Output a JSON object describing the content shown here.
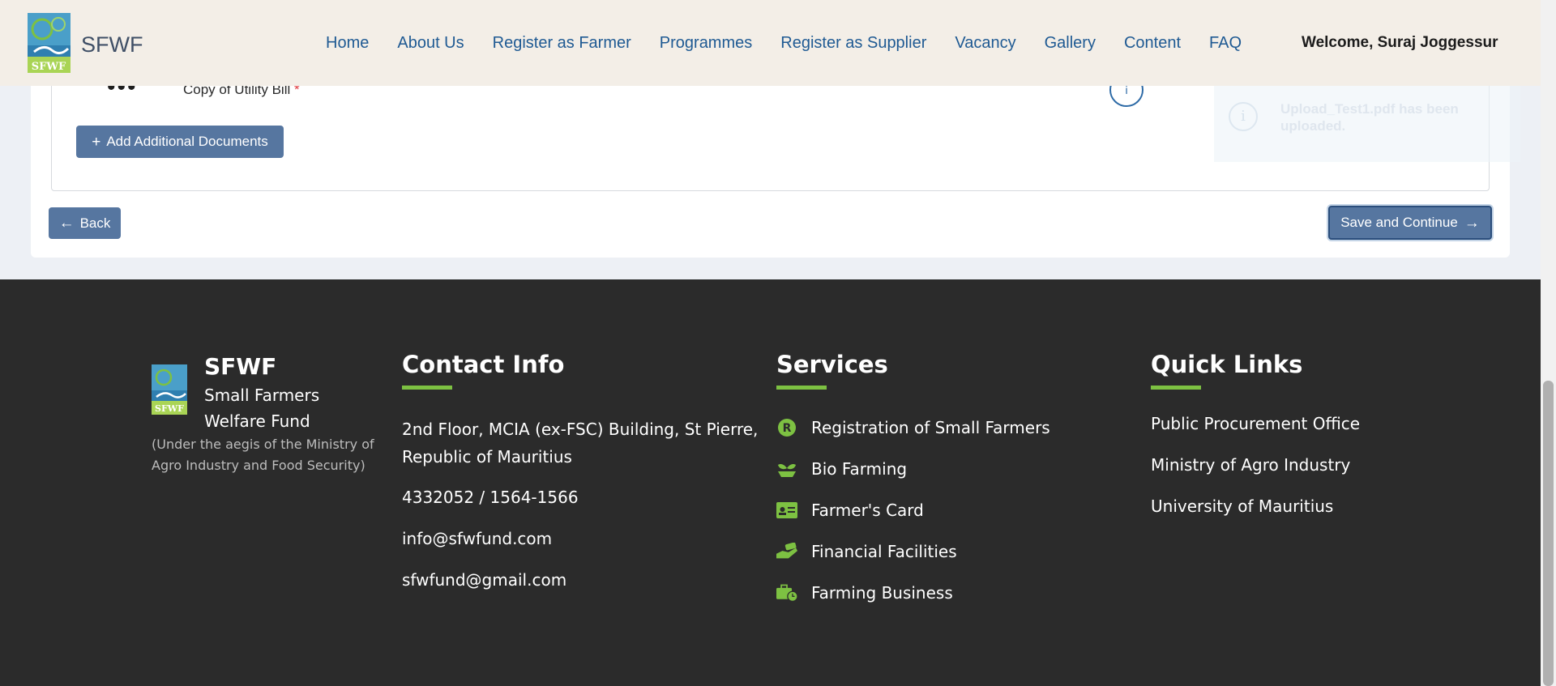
{
  "header": {
    "brand": "SFWF",
    "nav": [
      "Home",
      "About Us",
      "Register as Farmer",
      "Programmes",
      "Register as Supplier",
      "Vacancy",
      "Gallery",
      "Content",
      "FAQ"
    ],
    "welcome": "Welcome, Suraj Joggessur"
  },
  "documents": {
    "row_label": "Copy of Utility Bill",
    "required_marker": "*",
    "add_button": "Add Additional Documents"
  },
  "toast": {
    "message": "Upload_Test1.pdf has been uploaded."
  },
  "actions": {
    "back": "Back",
    "save": "Save and Continue"
  },
  "footer": {
    "brand": "SFWF",
    "subtitle_line1": "Small Farmers",
    "subtitle_line2": "Welfare Fund",
    "aegis": "(Under the aegis of the Ministry of Agro Industry and Food Security)",
    "contact": {
      "heading": "Contact Info",
      "address": "2nd Floor, MCIA (ex-FSC) Building, St Pierre, Republic of Mauritius",
      "phone": "4332052 / 1564-1566",
      "email1": "info@sfwfund.com",
      "email2": "sfwfund@gmail.com"
    },
    "services": {
      "heading": "Services",
      "items": [
        {
          "label": "Registration of Small Farmers",
          "icon": "registered-icon"
        },
        {
          "label": "Bio Farming",
          "icon": "seedling-icon"
        },
        {
          "label": "Farmer's Card",
          "icon": "id-card-icon"
        },
        {
          "label": "Financial Facilities",
          "icon": "hand-money-icon"
        },
        {
          "label": "Farming Business",
          "icon": "briefcase-clock-icon"
        }
      ]
    },
    "quick_links": {
      "heading": "Quick Links",
      "items": [
        "Public Procurement Office",
        "Ministry of Agro Industry",
        "University of Mauritius"
      ]
    }
  },
  "colors": {
    "accent": "#7dc142",
    "button": "#5676a0",
    "footer_bg": "#2b2b2b",
    "nav_link": "#1f5a93"
  }
}
